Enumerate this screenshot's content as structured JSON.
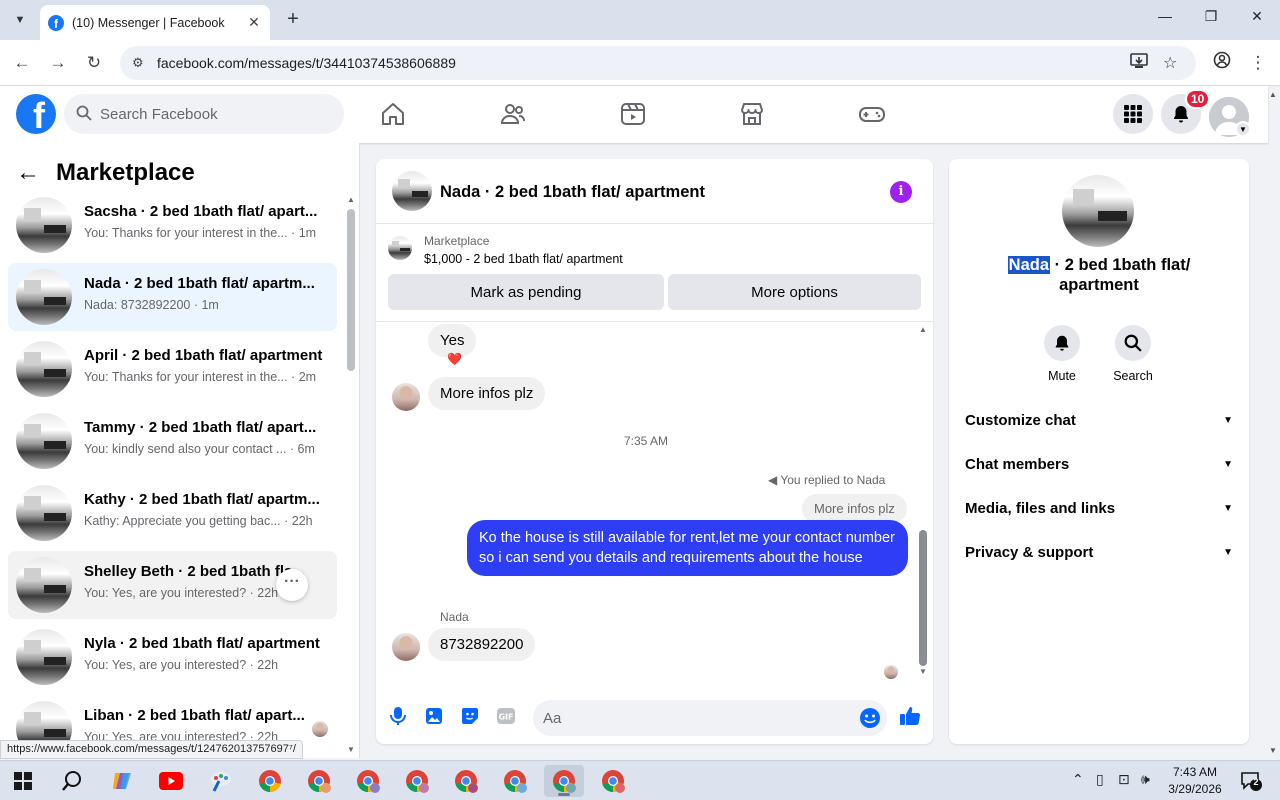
{
  "browser": {
    "tab_title": "(10) Messenger | Facebook",
    "url": "facebook.com/messages/t/34410374538606889",
    "status_url": "https://www.facebook.com/messages/t/124762013757697⁷/"
  },
  "fb_header": {
    "search_placeholder": "Search Facebook",
    "notification_count": "10",
    "brand_color": "#1877f2"
  },
  "sidebar": {
    "title": "Marketplace",
    "conversations": [
      {
        "name": "Sacsha · 2 bed 1bath flat/ apart...",
        "snippet": "You: Thanks for your interest in the... · 1m"
      },
      {
        "name": "Nada · 2 bed 1bath flat/ apartm...",
        "snippet": "Nada: 8732892200 · 1m"
      },
      {
        "name": "April · 2 bed 1bath flat/ apartment",
        "snippet": "You: Thanks for your interest in the... · 2m"
      },
      {
        "name": "Tammy · 2 bed 1bath flat/ apart...",
        "snippet": "You: kindly send also your contact ... · 6m"
      },
      {
        "name": "Kathy · 2 bed 1bath flat/ apartm...",
        "snippet": "Kathy: Appreciate you getting bac... · 22h"
      },
      {
        "name": "Shelley Beth · 2 bed 1bath fla...",
        "snippet": "You: Yes, are you interested? · 22h"
      },
      {
        "name": "Nyla · 2 bed 1bath flat/ apartment",
        "snippet": "You: Yes, are you interested? · 22h"
      },
      {
        "name": "Liban · 2 bed 1bath flat/ apart...",
        "snippet": "You: Yes, are you interested? · 22h"
      }
    ]
  },
  "chat": {
    "title": "Nada · 2 bed 1bath flat/ apartment",
    "marketplace_label": "Marketplace",
    "listing": "$1,000 - 2 bed 1bath flat/ apartment",
    "mark_pending": "Mark as pending",
    "more_options": "More options",
    "messages": {
      "yes": "Yes",
      "reaction": "❤️",
      "more_infos": "More infos plz",
      "timestamp": "7:35 AM",
      "replied_to": "You replied to Nada",
      "quoted": "More infos plz",
      "outgoing": "Ko the house is still available for rent,let me your contact number so i can send you details and requirements about the house",
      "sender": "Nada",
      "phone": "8732892200"
    },
    "composer_placeholder": "Aa",
    "accent_color": "#2e3ef5",
    "info_color": "#a020f0"
  },
  "info_panel": {
    "title_highlight": "Nada",
    "title_rest": " · 2 bed 1bath flat/ apartment",
    "mute": "Mute",
    "search": "Search",
    "sections": [
      "Customize chat",
      "Chat members",
      "Media, files and links",
      "Privacy & support"
    ]
  },
  "taskbar": {
    "time": "7:43 AM",
    "date": "3/29/2026",
    "notif_count": "2"
  }
}
